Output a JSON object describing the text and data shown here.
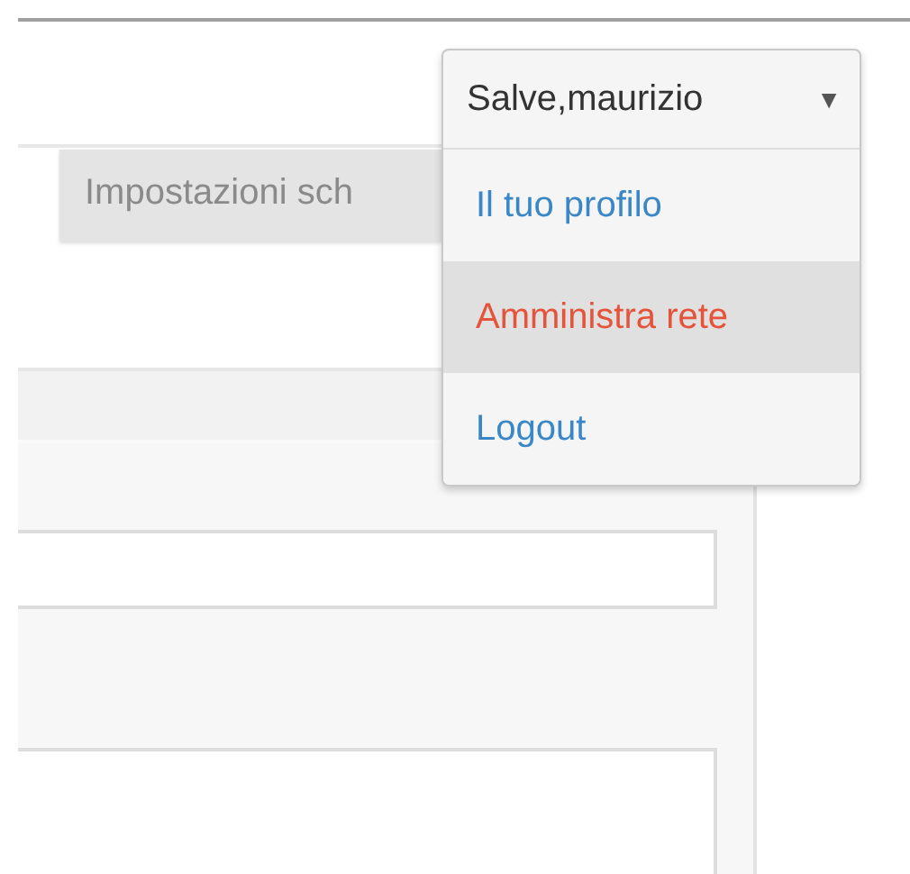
{
  "tabs": [
    {
      "label": "Impostazioni sch"
    }
  ],
  "user_menu": {
    "greeting": "Salve,maurizio",
    "caret": "▼",
    "items": [
      {
        "label": "Il tuo profilo",
        "selected": false
      },
      {
        "label": "Amministra rete",
        "selected": true
      },
      {
        "label": "Logout",
        "selected": false
      }
    ]
  }
}
